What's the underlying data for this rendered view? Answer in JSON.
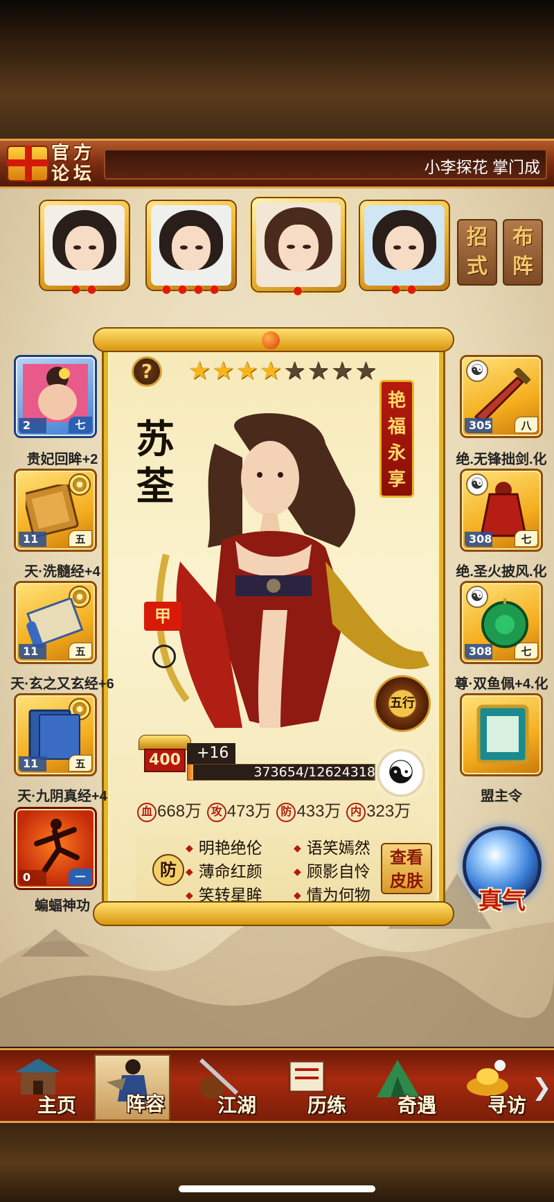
{
  "forum": {
    "label": "官方论坛",
    "notice": "小李探花 掌门成"
  },
  "top_buttons": {
    "moves": "招式",
    "formation": "布阵"
  },
  "hero": {
    "name": "苏荃",
    "title_tag": "艳福永享",
    "armor_tag": "甲",
    "stars_total": 8,
    "stars_lit": 4,
    "level": "400",
    "plus": "+16",
    "exp_text": "373654/12624318",
    "exp_current": 373654,
    "exp_max": 12624318,
    "wuxing": "五行",
    "taiji": "☯"
  },
  "stats": [
    {
      "icon": "血",
      "value": "668万"
    },
    {
      "icon": "攻",
      "value": "473万"
    },
    {
      "icon": "防",
      "value": "433万"
    },
    {
      "icon": "内",
      "value": "323万"
    }
  ],
  "traits": {
    "type_icon": "防",
    "left": [
      "明艳绝伦",
      "薄命红颜",
      "笑转星眸"
    ],
    "right": [
      "语笑嫣然",
      "顾影自怜",
      "情为何物"
    ]
  },
  "skin_button": "查看皮肤",
  "left_slots": [
    {
      "name": "贵妃回眸+2",
      "level": "2",
      "rank": "七"
    },
    {
      "name": "天·洗髓经+4",
      "level": "11",
      "rank": "五"
    },
    {
      "name": "天·玄之又玄经+6",
      "level": "11",
      "rank": "五"
    },
    {
      "name": "天·九阴真经+4",
      "level": "11",
      "rank": "五"
    },
    {
      "name": "蝙蝠神功",
      "level": "0",
      "rank": "一"
    }
  ],
  "right_slots": [
    {
      "name": "绝.无锋拙剑.化",
      "level": "305",
      "rank": "八"
    },
    {
      "name": "绝.圣火披风.化",
      "level": "308",
      "rank": "七"
    },
    {
      "name": "尊·双鱼佩+4.化",
      "level": "308",
      "rank": "七"
    },
    {
      "name": "盟主令",
      "level": "",
      "rank": ""
    }
  ],
  "zhenqi": "真气",
  "nav": [
    {
      "label": "主页"
    },
    {
      "label": "阵容"
    },
    {
      "label": "江湖"
    },
    {
      "label": "历练"
    },
    {
      "label": "奇遇"
    },
    {
      "label": "寻访"
    }
  ],
  "nav_more": "❯",
  "colors": {
    "gold": "#e7b52a",
    "accent_red": "#b41a0a",
    "nav_red": "#a82a0e"
  },
  "icons": {
    "portraits": [
      "hero-portrait-1",
      "hero-portrait-2",
      "hero-portrait-3",
      "hero-portrait-4"
    ],
    "help": "question-icon",
    "zhenqi": "crystal-orb-icon"
  }
}
